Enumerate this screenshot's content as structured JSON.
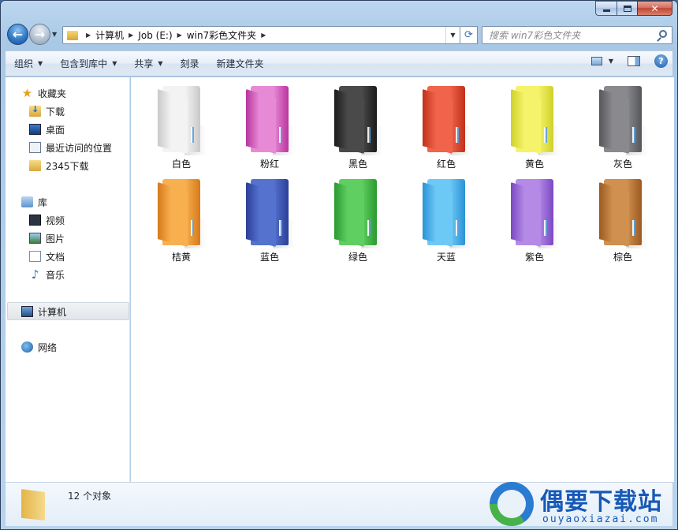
{
  "address_bar": {
    "crumbs": [
      "计算机",
      "Job (E:)",
      "win7彩色文件夹"
    ]
  },
  "search": {
    "placeholder": "搜索 win7彩色文件夹"
  },
  "toolbar": {
    "organize": "组织",
    "include_in_library": "包含到库中",
    "share": "共享",
    "burn": "刻录",
    "new_folder": "新建文件夹"
  },
  "sidebar": {
    "favorites": {
      "label": "收藏夹",
      "items": [
        {
          "label": "下载",
          "icon": "download-folder-icon"
        },
        {
          "label": "桌面",
          "icon": "desktop-icon"
        },
        {
          "label": "最近访问的位置",
          "icon": "recent-places-icon"
        },
        {
          "label": "2345下载",
          "icon": "folder-icon"
        }
      ]
    },
    "libraries": {
      "label": "库",
      "items": [
        {
          "label": "视频",
          "icon": "video-icon"
        },
        {
          "label": "图片",
          "icon": "pictures-icon"
        },
        {
          "label": "文档",
          "icon": "documents-icon"
        },
        {
          "label": "音乐",
          "icon": "music-icon"
        }
      ]
    },
    "computer": {
      "label": "计算机"
    },
    "network": {
      "label": "网络"
    }
  },
  "folders": [
    {
      "label": "白色",
      "color": "#f3f3f3",
      "dark": "#c9c9c9"
    },
    {
      "label": "粉红",
      "color": "#e78ad6",
      "dark": "#b9349f"
    },
    {
      "label": "黑色",
      "color": "#4a4a4a",
      "dark": "#1b1b1b"
    },
    {
      "label": "红色",
      "color": "#f0644b",
      "dark": "#c2301a"
    },
    {
      "label": "黄色",
      "color": "#f4f36a",
      "dark": "#cfd12a"
    },
    {
      "label": "灰色",
      "color": "#8a8a8e",
      "dark": "#55565b"
    },
    {
      "label": "桔黄",
      "color": "#f8b04f",
      "dark": "#d67a1a"
    },
    {
      "label": "蓝色",
      "color": "#5572cf",
      "dark": "#2b3f97"
    },
    {
      "label": "绿色",
      "color": "#5fcf62",
      "dark": "#2a9a30"
    },
    {
      "label": "天蓝",
      "color": "#6cc8f5",
      "dark": "#2a93d6"
    },
    {
      "label": "紫色",
      "color": "#b48ae6",
      "dark": "#7b48c2"
    },
    {
      "label": "棕色",
      "color": "#d0904f",
      "dark": "#9a5a22"
    }
  ],
  "details": {
    "count": "12 个对象"
  },
  "watermark": {
    "title": "偶要下载站",
    "url": "ouyaoxiazai.com"
  }
}
